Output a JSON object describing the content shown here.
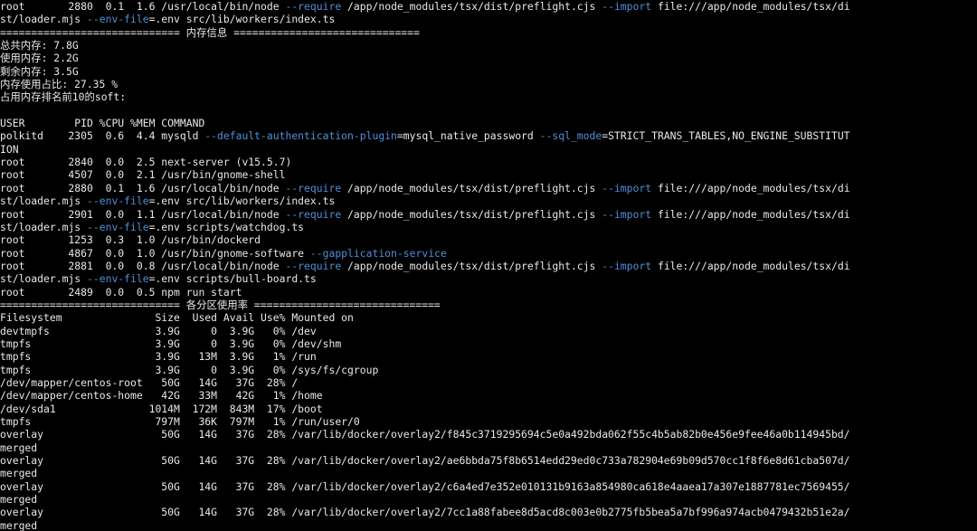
{
  "terminal": {
    "colors": {
      "background": "#000000",
      "foreground": "#e8e8e8",
      "flag": "#4f8fd6"
    },
    "lines": [
      [
        {
          "t": "root       2880  0.1  1.6 /usr/local/bin/node "
        },
        {
          "t": "--require",
          "k": "flag"
        },
        {
          "t": " /app/node_modules/tsx/dist/preflight.cjs "
        },
        {
          "t": "--import",
          "k": "flag"
        },
        {
          "t": " file:///app/node_modules/tsx/di"
        }
      ],
      [
        {
          "t": "st/loader.mjs "
        },
        {
          "t": "--env-file",
          "k": "flag"
        },
        {
          "t": "=.env src/lib/workers/index.ts"
        }
      ],
      [
        {
          "t": "============================= 内存信息 =============================="
        }
      ],
      [
        {
          "t": "总共内存: 7.8G"
        }
      ],
      [
        {
          "t": "使用内存: 2.2G"
        }
      ],
      [
        {
          "t": "剩余内存: 3.5G"
        }
      ],
      [
        {
          "t": "内存使用占比: 27.35 %"
        }
      ],
      [
        {
          "t": "占用内存排名前10的soft:"
        }
      ],
      [
        {
          "t": ""
        }
      ],
      [
        {
          "t": "USER        PID %CPU %MEM COMMAND"
        }
      ],
      [
        {
          "t": "polkitd    2305  0.6  4.4 mysqld "
        },
        {
          "t": "--default-authentication-plugin",
          "k": "flag"
        },
        {
          "t": "=mysql_native_password "
        },
        {
          "t": "--sql_mode",
          "k": "flag"
        },
        {
          "t": "=STRICT_TRANS_TABLES,NO_ENGINE_SUBSTITUT"
        }
      ],
      [
        {
          "t": "ION"
        }
      ],
      [
        {
          "t": "root       2840  0.0  2.5 next-server (v15.5.7)"
        }
      ],
      [
        {
          "t": "root       4507  0.0  2.1 /usr/bin/gnome-shell"
        }
      ],
      [
        {
          "t": "root       2880  0.1  1.6 /usr/local/bin/node "
        },
        {
          "t": "--require",
          "k": "flag"
        },
        {
          "t": " /app/node_modules/tsx/dist/preflight.cjs "
        },
        {
          "t": "--import",
          "k": "flag"
        },
        {
          "t": " file:///app/node_modules/tsx/di"
        }
      ],
      [
        {
          "t": "st/loader.mjs "
        },
        {
          "t": "--env-file",
          "k": "flag"
        },
        {
          "t": "=.env src/lib/workers/index.ts"
        }
      ],
      [
        {
          "t": "root       2901  0.0  1.1 /usr/local/bin/node "
        },
        {
          "t": "--require",
          "k": "flag"
        },
        {
          "t": " /app/node_modules/tsx/dist/preflight.cjs "
        },
        {
          "t": "--import",
          "k": "flag"
        },
        {
          "t": " file:///app/node_modules/tsx/di"
        }
      ],
      [
        {
          "t": "st/loader.mjs "
        },
        {
          "t": "--env-file",
          "k": "flag"
        },
        {
          "t": "=.env scripts/watchdog.ts"
        }
      ],
      [
        {
          "t": "root       1253  0.3  1.0 /usr/bin/dockerd"
        }
      ],
      [
        {
          "t": "root       4867  0.0  1.0 /usr/bin/gnome-software "
        },
        {
          "t": "--gapplication-service",
          "k": "flag"
        }
      ],
      [
        {
          "t": "root       2881  0.0  0.8 /usr/local/bin/node "
        },
        {
          "t": "--require",
          "k": "flag"
        },
        {
          "t": " /app/node_modules/tsx/dist/preflight.cjs "
        },
        {
          "t": "--import",
          "k": "flag"
        },
        {
          "t": " file:///app/node_modules/tsx/di"
        }
      ],
      [
        {
          "t": "st/loader.mjs "
        },
        {
          "t": "--env-file",
          "k": "flag"
        },
        {
          "t": "=.env scripts/bull-board.ts"
        }
      ],
      [
        {
          "t": "root       2489  0.0  0.5 npm run start"
        }
      ],
      [
        {
          "t": "============================= 各分区使用率 =============================="
        }
      ],
      [
        {
          "t": "Filesystem               Size  Used Avail Use% Mounted on"
        }
      ],
      [
        {
          "t": "devtmpfs                 3.9G     0  3.9G   0% /dev"
        }
      ],
      [
        {
          "t": "tmpfs                    3.9G     0  3.9G   0% /dev/shm"
        }
      ],
      [
        {
          "t": "tmpfs                    3.9G   13M  3.9G   1% /run"
        }
      ],
      [
        {
          "t": "tmpfs                    3.9G     0  3.9G   0% /sys/fs/cgroup"
        }
      ],
      [
        {
          "t": "/dev/mapper/centos-root   50G   14G   37G  28% /"
        }
      ],
      [
        {
          "t": "/dev/mapper/centos-home   42G   33M   42G   1% /home"
        }
      ],
      [
        {
          "t": "/dev/sda1               1014M  172M  843M  17% /boot"
        }
      ],
      [
        {
          "t": "tmpfs                    797M   36K  797M   1% /run/user/0"
        }
      ],
      [
        {
          "t": "overlay                   50G   14G   37G  28% /var/lib/docker/overlay2/f845c3719295694c5e0a492bda062f55c4b5ab82b0e456e9fee46a0b114945bd/"
        }
      ],
      [
        {
          "t": "merged"
        }
      ],
      [
        {
          "t": "overlay                   50G   14G   37G  28% /var/lib/docker/overlay2/ae6bbda75f8b6514edd29ed0c733a782904e69b09d570cc1f8f6e8d61cba507d/"
        }
      ],
      [
        {
          "t": "merged"
        }
      ],
      [
        {
          "t": "overlay                   50G   14G   37G  28% /var/lib/docker/overlay2/c6a4ed7e352e010131b9163a854980ca618e4aaea17a307e1887781ec7569455/"
        }
      ],
      [
        {
          "t": "merged"
        }
      ],
      [
        {
          "t": "overlay                   50G   14G   37G  28% /var/lib/docker/overlay2/7cc1a88fabee8d5acd8c003e0b2775fb5bea5a7bf996a974acb0479432b51e2a/"
        }
      ],
      [
        {
          "t": "merged"
        }
      ]
    ]
  }
}
